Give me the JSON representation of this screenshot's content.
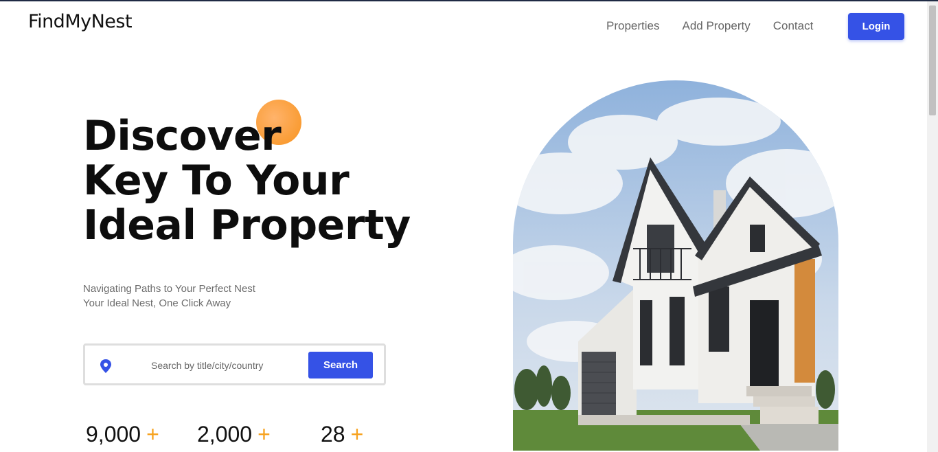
{
  "brand": {
    "logo_text": "FindMyNest"
  },
  "nav": {
    "links": [
      {
        "label": "Properties"
      },
      {
        "label": "Add Property"
      },
      {
        "label": "Contact"
      }
    ],
    "login_label": "Login"
  },
  "hero": {
    "title_lines": [
      "Discover",
      "Key To Your",
      "Ideal Property"
    ],
    "subtitle_lines": [
      "Navigating Paths to Your Perfect Nest",
      "Your Ideal Nest, One Click Away"
    ]
  },
  "search": {
    "placeholder": "Search by title/city/country",
    "value": "",
    "button_label": "Search",
    "icon": "location-pin-icon"
  },
  "stats": [
    {
      "value": "9,000",
      "suffix": "+"
    },
    {
      "value": "2,000",
      "suffix": "+"
    },
    {
      "value": "28",
      "suffix": "+"
    }
  ],
  "colors": {
    "accent": "#3552e6",
    "orange": "#f7a21e",
    "text_dark": "#0d0d0d",
    "text_muted": "#6b6b6b"
  },
  "hero_image": {
    "subject": "modern-house-photo"
  }
}
